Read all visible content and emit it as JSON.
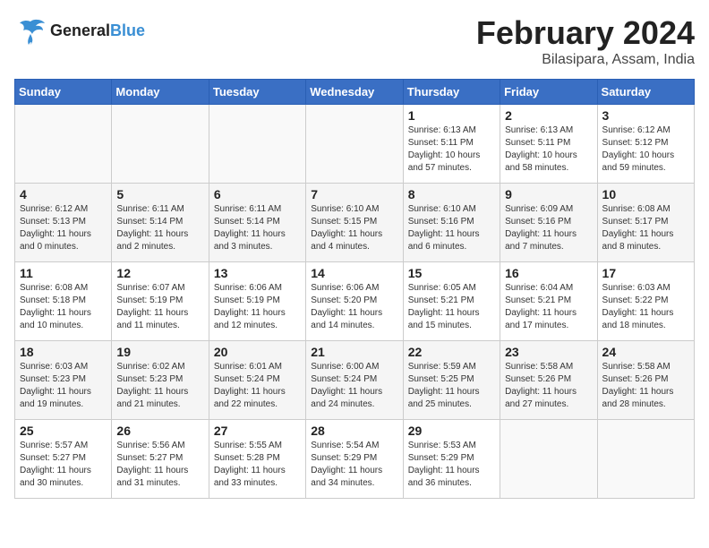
{
  "header": {
    "logo_line1": "General",
    "logo_line2": "Blue",
    "title": "February 2024",
    "subtitle": "Bilasipara, Assam, India"
  },
  "weekdays": [
    "Sunday",
    "Monday",
    "Tuesday",
    "Wednesday",
    "Thursday",
    "Friday",
    "Saturday"
  ],
  "weeks": [
    [
      {
        "day": "",
        "info": ""
      },
      {
        "day": "",
        "info": ""
      },
      {
        "day": "",
        "info": ""
      },
      {
        "day": "",
        "info": ""
      },
      {
        "day": "1",
        "info": "Sunrise: 6:13 AM\nSunset: 5:11 PM\nDaylight: 10 hours\nand 57 minutes."
      },
      {
        "day": "2",
        "info": "Sunrise: 6:13 AM\nSunset: 5:11 PM\nDaylight: 10 hours\nand 58 minutes."
      },
      {
        "day": "3",
        "info": "Sunrise: 6:12 AM\nSunset: 5:12 PM\nDaylight: 10 hours\nand 59 minutes."
      }
    ],
    [
      {
        "day": "4",
        "info": "Sunrise: 6:12 AM\nSunset: 5:13 PM\nDaylight: 11 hours\nand 0 minutes."
      },
      {
        "day": "5",
        "info": "Sunrise: 6:11 AM\nSunset: 5:14 PM\nDaylight: 11 hours\nand 2 minutes."
      },
      {
        "day": "6",
        "info": "Sunrise: 6:11 AM\nSunset: 5:14 PM\nDaylight: 11 hours\nand 3 minutes."
      },
      {
        "day": "7",
        "info": "Sunrise: 6:10 AM\nSunset: 5:15 PM\nDaylight: 11 hours\nand 4 minutes."
      },
      {
        "day": "8",
        "info": "Sunrise: 6:10 AM\nSunset: 5:16 PM\nDaylight: 11 hours\nand 6 minutes."
      },
      {
        "day": "9",
        "info": "Sunrise: 6:09 AM\nSunset: 5:16 PM\nDaylight: 11 hours\nand 7 minutes."
      },
      {
        "day": "10",
        "info": "Sunrise: 6:08 AM\nSunset: 5:17 PM\nDaylight: 11 hours\nand 8 minutes."
      }
    ],
    [
      {
        "day": "11",
        "info": "Sunrise: 6:08 AM\nSunset: 5:18 PM\nDaylight: 11 hours\nand 10 minutes."
      },
      {
        "day": "12",
        "info": "Sunrise: 6:07 AM\nSunset: 5:19 PM\nDaylight: 11 hours\nand 11 minutes."
      },
      {
        "day": "13",
        "info": "Sunrise: 6:06 AM\nSunset: 5:19 PM\nDaylight: 11 hours\nand 12 minutes."
      },
      {
        "day": "14",
        "info": "Sunrise: 6:06 AM\nSunset: 5:20 PM\nDaylight: 11 hours\nand 14 minutes."
      },
      {
        "day": "15",
        "info": "Sunrise: 6:05 AM\nSunset: 5:21 PM\nDaylight: 11 hours\nand 15 minutes."
      },
      {
        "day": "16",
        "info": "Sunrise: 6:04 AM\nSunset: 5:21 PM\nDaylight: 11 hours\nand 17 minutes."
      },
      {
        "day": "17",
        "info": "Sunrise: 6:03 AM\nSunset: 5:22 PM\nDaylight: 11 hours\nand 18 minutes."
      }
    ],
    [
      {
        "day": "18",
        "info": "Sunrise: 6:03 AM\nSunset: 5:23 PM\nDaylight: 11 hours\nand 19 minutes."
      },
      {
        "day": "19",
        "info": "Sunrise: 6:02 AM\nSunset: 5:23 PM\nDaylight: 11 hours\nand 21 minutes."
      },
      {
        "day": "20",
        "info": "Sunrise: 6:01 AM\nSunset: 5:24 PM\nDaylight: 11 hours\nand 22 minutes."
      },
      {
        "day": "21",
        "info": "Sunrise: 6:00 AM\nSunset: 5:24 PM\nDaylight: 11 hours\nand 24 minutes."
      },
      {
        "day": "22",
        "info": "Sunrise: 5:59 AM\nSunset: 5:25 PM\nDaylight: 11 hours\nand 25 minutes."
      },
      {
        "day": "23",
        "info": "Sunrise: 5:58 AM\nSunset: 5:26 PM\nDaylight: 11 hours\nand 27 minutes."
      },
      {
        "day": "24",
        "info": "Sunrise: 5:58 AM\nSunset: 5:26 PM\nDaylight: 11 hours\nand 28 minutes."
      }
    ],
    [
      {
        "day": "25",
        "info": "Sunrise: 5:57 AM\nSunset: 5:27 PM\nDaylight: 11 hours\nand 30 minutes."
      },
      {
        "day": "26",
        "info": "Sunrise: 5:56 AM\nSunset: 5:27 PM\nDaylight: 11 hours\nand 31 minutes."
      },
      {
        "day": "27",
        "info": "Sunrise: 5:55 AM\nSunset: 5:28 PM\nDaylight: 11 hours\nand 33 minutes."
      },
      {
        "day": "28",
        "info": "Sunrise: 5:54 AM\nSunset: 5:29 PM\nDaylight: 11 hours\nand 34 minutes."
      },
      {
        "day": "29",
        "info": "Sunrise: 5:53 AM\nSunset: 5:29 PM\nDaylight: 11 hours\nand 36 minutes."
      },
      {
        "day": "",
        "info": ""
      },
      {
        "day": "",
        "info": ""
      }
    ]
  ]
}
